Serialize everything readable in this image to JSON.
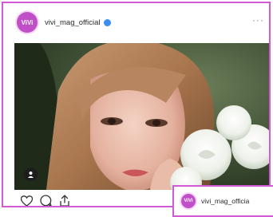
{
  "post": {
    "avatar_initials": "ViVi",
    "username": "vivi_mag_official",
    "verified": true,
    "more_label": "···"
  },
  "embed_card": {
    "avatar_initials": "ViVi",
    "username": "vivi_mag_officia"
  },
  "icons": {
    "like": "heart-icon",
    "comment": "comment-icon",
    "share": "share-icon",
    "tag": "user-tag-icon",
    "verified": "verified-badge-icon"
  },
  "colors": {
    "accent_border": "#d35ad6",
    "avatar_bg": "#c050c8",
    "verified": "#3c8df0"
  }
}
